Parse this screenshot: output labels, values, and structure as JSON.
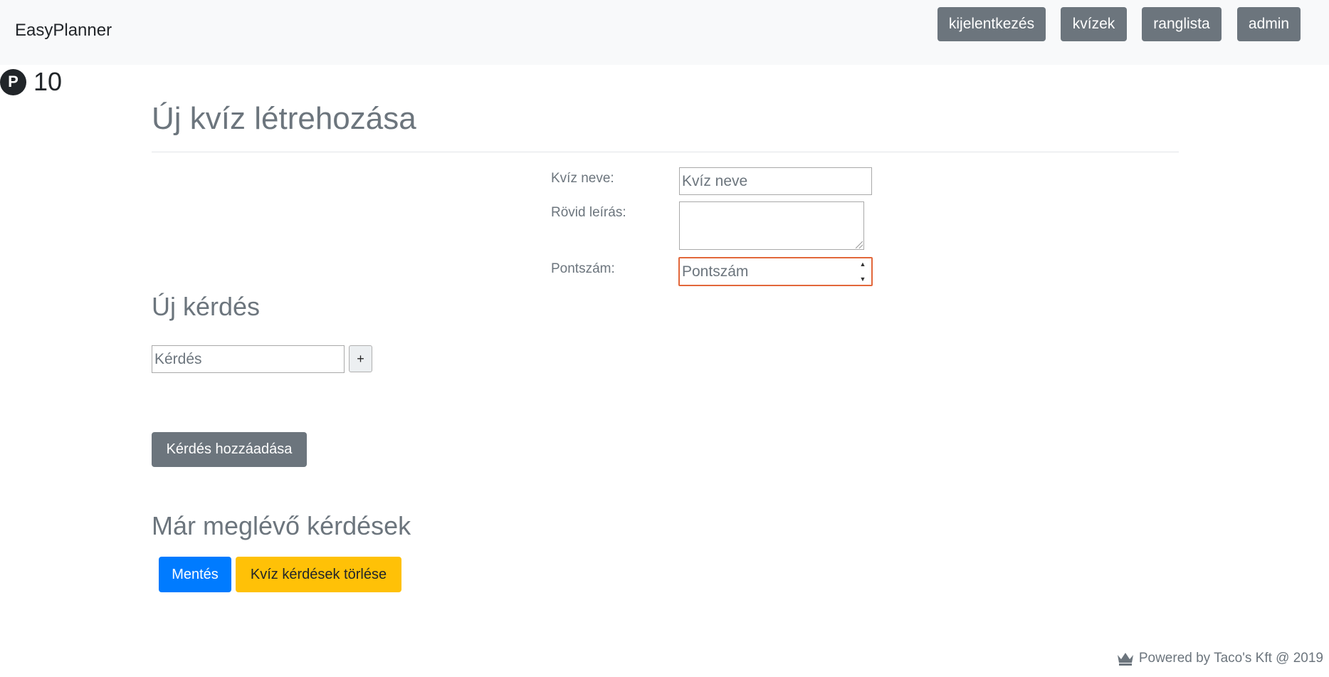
{
  "brand": "EasyPlanner",
  "nav": {
    "logout": "kijelentkezés",
    "quizzes": "kvízek",
    "leaderboard": "ranglista",
    "admin": "admin"
  },
  "points": {
    "icon_letter": "P",
    "value": "10"
  },
  "page_title": "Új kvíz létrehozása",
  "form": {
    "name_label": "Kvíz neve:",
    "name_placeholder": "Kvíz neve",
    "description_label": "Rövid leírás:",
    "score_label": "Pontszám:",
    "score_placeholder": "Pontszám"
  },
  "new_question": {
    "heading": "Új kérdés",
    "question_placeholder": "Kérdés",
    "plus_label": "+",
    "add_button": "Kérdés hozzáadása"
  },
  "existing": {
    "heading": "Már meglévő kérdések",
    "save_button": "Mentés",
    "delete_button": "Kvíz kérdések törlése"
  },
  "footer": {
    "text": "Powered by Taco's Kft @ 2019",
    "icon": "crown-icon"
  },
  "colors": {
    "secondary": "#6c757d",
    "primary": "#007bff",
    "warning": "#ffc107",
    "focus_border": "#e2673a"
  }
}
